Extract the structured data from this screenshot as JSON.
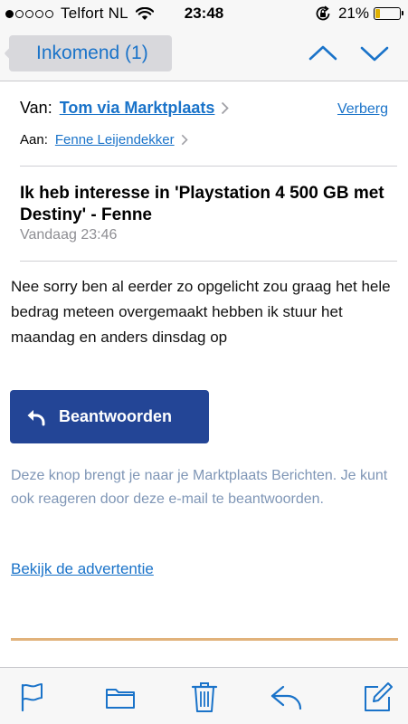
{
  "status_bar": {
    "carrier": "Telfort NL",
    "signal_bars_filled": 1,
    "signal_bars_total": 5,
    "time": "23:48",
    "battery_percent": "21%",
    "battery_level": 0.21,
    "battery_color": "#e0b100",
    "icons": [
      "wifi-icon",
      "rotation-lock-icon",
      "battery-icon"
    ]
  },
  "nav": {
    "back_label": "Inkomend (1)",
    "prev_icon": "chevron-up-icon",
    "next_icon": "chevron-down-icon"
  },
  "header": {
    "from_label": "Van:",
    "from_name": "Tom via Marktplaats",
    "hide_label": "Verberg",
    "to_label": "Aan:",
    "to_name": "Fenne Leijendekker"
  },
  "message": {
    "subject": "Ik heb interesse in 'Playstation 4 500 GB met Destiny' - Fenne",
    "date": "Vandaag 23:46",
    "body": "Nee sorry ben al eerder zo opgelicht zou graag het hele bedrag meteen overgemaakt hebben ik stuur het maandag en anders dinsdag op",
    "reply_button_label": "Beantwoorden",
    "hint": "Deze knop brengt je naar je Marktplaats Berichten. Je kunt ook reageren door deze e-mail te beantwoorden.",
    "ad_link": "Bekijk de advertentie"
  },
  "toolbar": {
    "icons": [
      "flag-icon",
      "folder-icon",
      "trash-icon",
      "reply-icon",
      "compose-icon"
    ]
  },
  "colors": {
    "accent_blue": "#1a73c9",
    "button_blue": "#234596",
    "hint_text": "#7f96b6",
    "divider_accent": "#e1b27b"
  }
}
